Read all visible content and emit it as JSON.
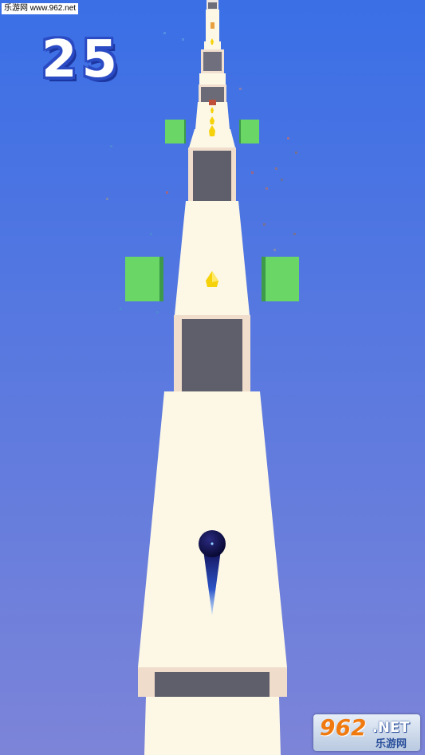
{
  "watermark": {
    "site": "乐游网 www.962.net"
  },
  "hud": {
    "score": "25"
  },
  "logo": {
    "number": "962",
    "net": ".NET",
    "cn": "乐游网"
  },
  "colors": {
    "sky_top": "#3a6fe6",
    "sky_bottom": "#7a84d8",
    "path": "#fdf8e6",
    "gap": "#5f5f6c",
    "cube": "#69d666",
    "gem": "#f5d20a",
    "ball": "#0c0c4a"
  }
}
